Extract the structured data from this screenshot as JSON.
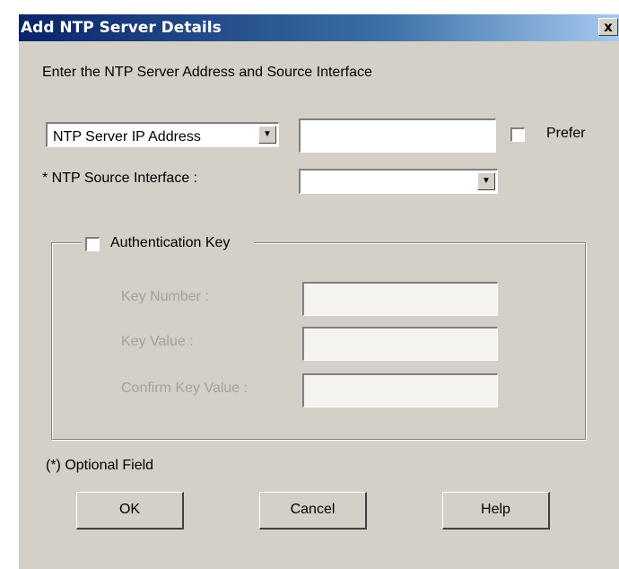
{
  "window": {
    "title": "Add NTP Server Details",
    "close_label": "x"
  },
  "form": {
    "instruction": "Enter the NTP Server Address and Source Interface",
    "address_type": {
      "selected": "NTP Server IP Address"
    },
    "address_value": "",
    "prefer": {
      "label": "Prefer",
      "checked": false
    },
    "source_interface": {
      "label": "* NTP Source Interface :",
      "selected": ""
    },
    "authentication": {
      "label": "Authentication Key",
      "checked": false,
      "key_number_label": "Key Number :",
      "key_value_label": "Key Value :",
      "confirm_key_value_label": "Confirm Key Value :"
    },
    "optional_note": "(*) Optional Field"
  },
  "buttons": {
    "ok": "OK",
    "cancel": "Cancel",
    "help": "Help"
  }
}
